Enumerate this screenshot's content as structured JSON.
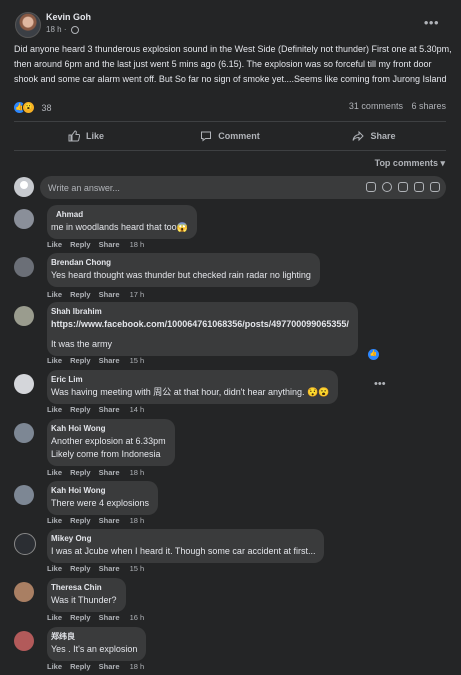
{
  "post": {
    "author": "Kevin Goh",
    "time": "18 h",
    "text": "Did anyone heard 3 thunderous explosion sound in the West Side (Definitely not thunder) First one at 5.30pm, then around 6pm and the last just went 5 mins ago (6.15). The explosion was so forceful till my front door shook and some car alarm went off. But So far no sign of smoke yet....Seems like coming from Jurong Island",
    "reaction_count": "38",
    "comments_count": "31 comments",
    "shares_count": "6 shares"
  },
  "actions": {
    "like": "Like",
    "comment": "Comment",
    "share": "Share"
  },
  "sort": {
    "label": "Top comments"
  },
  "compose": {
    "placeholder": "Write an answer..."
  },
  "comment_actions": {
    "like": "Like",
    "reply": "Reply",
    "share": "Share"
  },
  "comments": [
    {
      "name": "Ahmad",
      "lines": [
        "me in woodlands heard that too😱"
      ],
      "time": "18 h"
    },
    {
      "name": "Brendan Chong",
      "lines": [
        "Yes heard thought was thunder but checked rain radar no lighting"
      ],
      "time": "17 h"
    },
    {
      "name": "Shah Ibrahim",
      "lines": [
        "https://www.facebook.com/100064761068356/posts/497700099065355/",
        "",
        "It was the army"
      ],
      "time": "15 h"
    },
    {
      "name": "Eric Lim",
      "lines": [
        "Was having meeting with 周公 at that hour, didn't hear anything. 😯😮"
      ],
      "time": "14 h"
    },
    {
      "name": "Kah Hoi Wong",
      "lines": [
        "Another explosion at 6.33pm",
        "Likely come from Indonesia"
      ],
      "time": "18 h"
    },
    {
      "name": "Kah Hoi Wong",
      "lines": [
        "There were 4 explosions"
      ],
      "time": "18 h"
    },
    {
      "name": "Mikey Ong",
      "lines": [
        "I was at Jcube when I heard it. Though some car accident at first..."
      ],
      "time": "15 h"
    },
    {
      "name": "Theresa Chin",
      "lines": [
        "Was it Thunder?"
      ],
      "time": "16 h"
    },
    {
      "name": "郑纬良",
      "lines": [
        "Yes . It's an explosion"
      ],
      "time": "18 h"
    }
  ],
  "colors": {
    "background": "#242526",
    "bubble": "#3a3b3c",
    "accent": "#2d88ff",
    "text": "#e4e6eb",
    "muted": "#b0b3b8"
  }
}
